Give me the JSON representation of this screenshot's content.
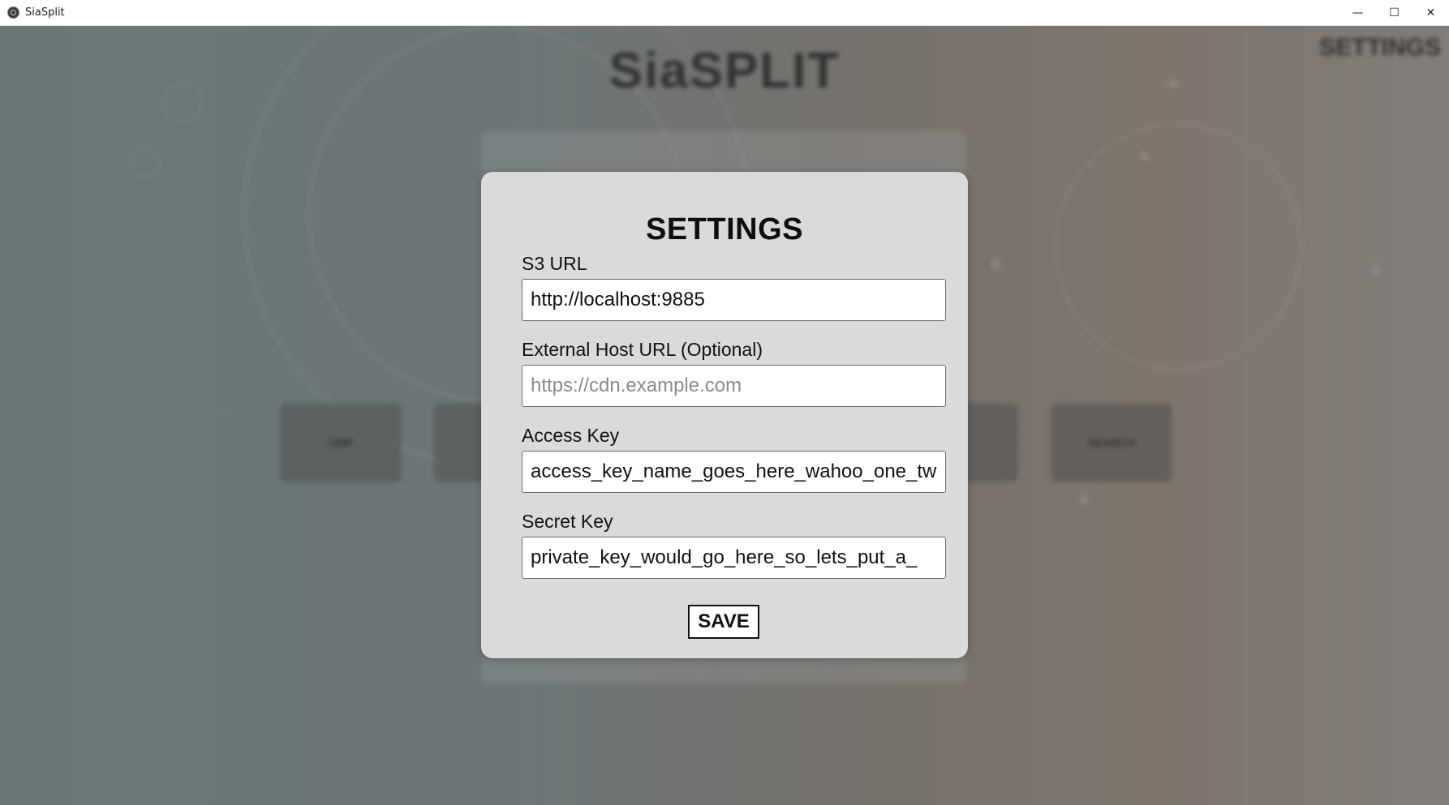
{
  "window": {
    "title": "SiaSplit",
    "controls": {
      "minimize": "—",
      "maximize": "☐",
      "close": "✕"
    }
  },
  "background": {
    "logo": "SiaSPLIT",
    "settings_link": "SETTINGS",
    "buttons": [
      "UNP",
      "",
      "",
      "",
      "",
      "SEARCH"
    ]
  },
  "settings_modal": {
    "title": "SETTINGS",
    "s3_url": {
      "label": "S3 URL",
      "value": "http://localhost:9885",
      "placeholder": ""
    },
    "external_host": {
      "label": "External Host URL (Optional)",
      "value": "",
      "placeholder": "https://cdn.example.com"
    },
    "access_key": {
      "label": "Access Key",
      "value": "access_key_name_goes_here_wahoo_one_tw",
      "placeholder": ""
    },
    "secret_key": {
      "label": "Secret Key",
      "value": "private_key_would_go_here_so_lets_put_a_",
      "placeholder": ""
    },
    "save_label": "SAVE"
  },
  "colors": {
    "modal_bg": "#dadada",
    "overlay": "rgba(70,70,70,0.5)",
    "text": "#111111"
  }
}
